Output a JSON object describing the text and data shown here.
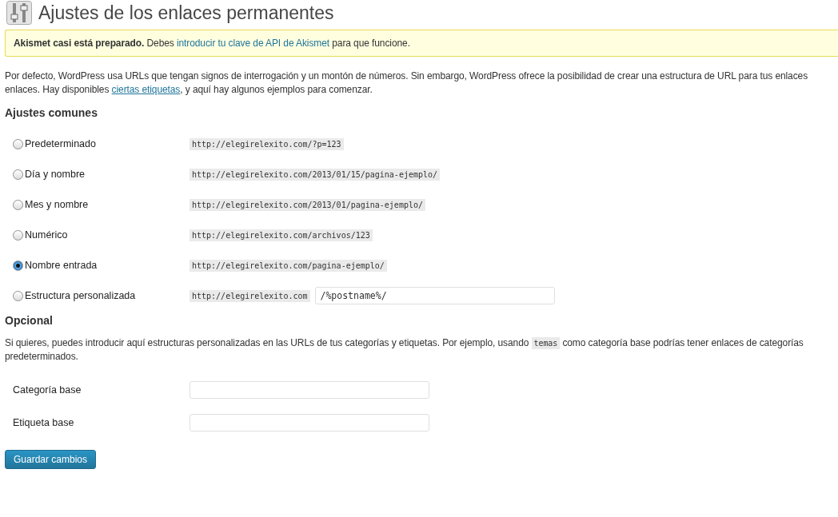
{
  "page": {
    "title": "Ajustes de los enlaces permanentes"
  },
  "notice": {
    "bold": "Akismet casi está preparado.",
    "before": " Debes ",
    "link": "introducir tu clave de API de Akismet",
    "after": " para que funcione."
  },
  "intro": {
    "line_1": "Por defecto, WordPress usa URLs que tengan signos de interrogación y un montón de números. Sin embargo, WordPress ofrece la posibilidad de crear una estructura de URL para tus enlaces",
    "line_2_before": "enlaces. Hay disponibles ",
    "line_2_link": "ciertas etiquetas",
    "line_2_after": ", y aquí hay algunos ejemplos para comenzar."
  },
  "common_settings": {
    "heading": "Ajustes comunes",
    "options": [
      {
        "label": "Predeterminado",
        "example": "http://elegirelexito.com/?p=123",
        "selected": false
      },
      {
        "label": "Día y nombre",
        "example": "http://elegirelexito.com/2013/01/15/pagina-ejemplo/",
        "selected": false
      },
      {
        "label": "Mes y nombre",
        "example": "http://elegirelexito.com/2013/01/pagina-ejemplo/",
        "selected": false
      },
      {
        "label": "Numérico",
        "example": "http://elegirelexito.com/archivos/123",
        "selected": false
      },
      {
        "label": "Nombre entrada",
        "example": "http://elegirelexito.com/pagina-ejemplo/",
        "selected": true
      },
      {
        "label": "Estructura personalizada",
        "example": "http://elegirelexito.com",
        "value": "/%postname%/",
        "selected": false
      }
    ]
  },
  "optional": {
    "heading": "Opcional",
    "line_1_before": "Si quieres, puedes introducir aquí estructuras personalizadas en las URLs de tus categorías y etiquetas. Por ejemplo, usando ",
    "line_1_code": "temas",
    "line_1_after": " como categoría base podrías tener enlaces de categorías",
    "line_2": "predeterminados.",
    "fields": [
      {
        "label": "Categoría base"
      },
      {
        "label": "Etiqueta base"
      }
    ]
  },
  "save_button": "Guardar cambios"
}
